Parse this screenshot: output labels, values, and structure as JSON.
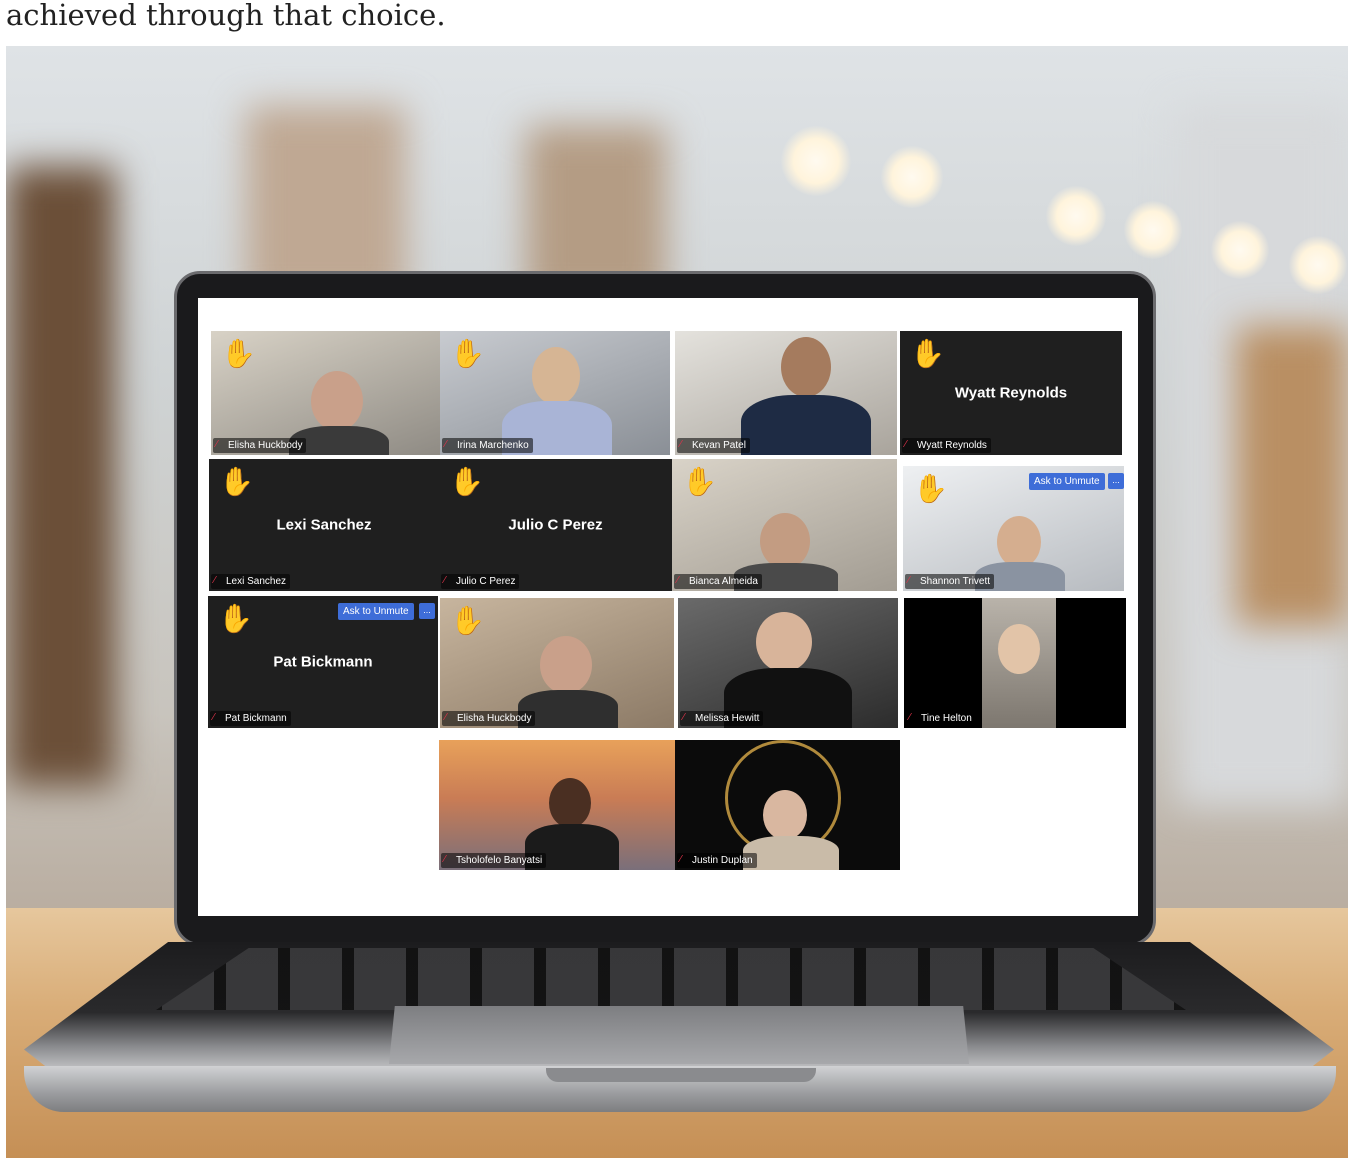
{
  "caption": {
    "line1": "",
    "line2": "achieved through that choice."
  },
  "meeting": {
    "participants": [
      {
        "name": "Elisha Huckbody",
        "hand_raised": true
      },
      {
        "name": "Irina Marchenko",
        "hand_raised": true
      },
      {
        "name": "Kevan Patel",
        "hand_raised": false
      },
      {
        "name": "Wyatt Reynolds",
        "hand_raised": true,
        "display_name": "Wyatt Reynolds"
      },
      {
        "name": "Lexi Sanchez",
        "hand_raised": true,
        "display_name": "Lexi Sanchez"
      },
      {
        "name": "Julio C Perez",
        "hand_raised": true,
        "display_name": "Julio C Perez"
      },
      {
        "name": "Bianca Almeida",
        "hand_raised": true
      },
      {
        "name": "Shannon Trivett",
        "hand_raised": true,
        "action": "Ask to Unmute",
        "more": "..."
      },
      {
        "name": "Pat Bickmann",
        "hand_raised": true,
        "display_name": "Pat Bickmann",
        "action": "Ask to Unmute",
        "more": "..."
      },
      {
        "name": "Elisha Huckbody",
        "hand_raised": true
      },
      {
        "name": "Melissa Hewitt",
        "hand_raised": false
      },
      {
        "name": "Tine Helton",
        "hand_raised": false
      },
      {
        "name": "Tsholofelo Banyatsi",
        "hand_raised": false
      },
      {
        "name": "Justin Duplan",
        "hand_raised": false
      }
    ],
    "icons": {
      "hand": "raised-hand-icon",
      "mic": "muted-mic-icon"
    },
    "colors": {
      "tile_dark": "#1f1f1f",
      "unmute_button": "#3e6dd8",
      "muted_icon": "#e0334a",
      "hand": "#f2b705"
    }
  }
}
